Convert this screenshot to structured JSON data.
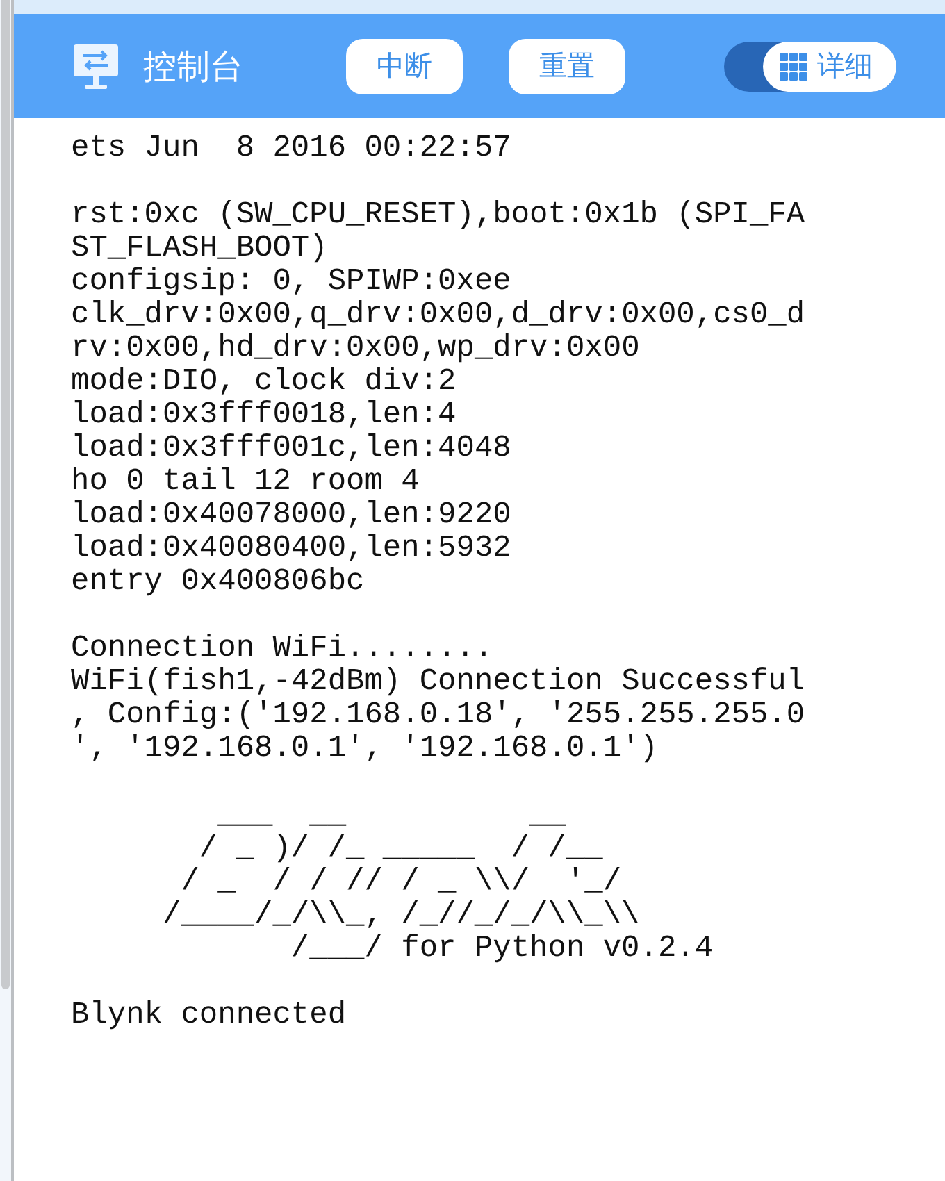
{
  "header": {
    "title": "控制台",
    "buttons": [
      "中断",
      "重置"
    ],
    "detail_toggle": {
      "label": "详细",
      "on": true
    }
  },
  "console": {
    "blocks": [
      {
        "lines": [
          "ets Jun  8 2016 00:22:57"
        ]
      },
      {
        "lines": [
          "rst:0xc (SW_CPU_RESET),boot:0x1b (SPI_FA",
          "ST_FLASH_BOOT)",
          "configsip: 0, SPIWP:0xee",
          "clk_drv:0x00,q_drv:0x00,d_drv:0x00,cs0_d",
          "rv:0x00,hd_drv:0x00,wp_drv:0x00",
          "mode:DIO, clock div:2",
          "load:0x3fff0018,len:4",
          "load:0x3fff001c,len:4048",
          "ho 0 tail 12 room 4",
          "load:0x40078000,len:9220",
          "load:0x40080400,len:5932",
          "entry 0x400806bc"
        ]
      },
      {
        "lines": [
          "Connection WiFi........",
          "WiFi(fish1,-42dBm) Connection Successful",
          ", Config:('192.168.0.18', '255.255.255.0",
          "', '192.168.0.1', '192.168.0.1')"
        ]
      },
      {
        "lines": [
          "        ___  __          __",
          "       / _ )/ /_ _____  / /__",
          "      / _  / / // / _ \\\\/  '_/",
          "     /____/_/\\\\_, /_//_/_/\\\\_\\\\",
          "            /___/ for Python v0.2.4"
        ]
      },
      {
        "lines": [
          "Blynk connected"
        ]
      }
    ]
  }
}
